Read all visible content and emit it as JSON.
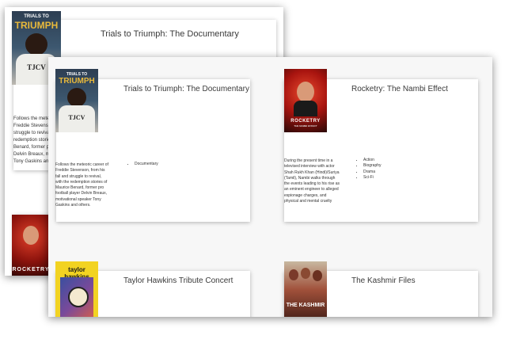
{
  "back_window": {
    "card1": {
      "title": "Trials to Triumph: The Documentary",
      "poster_text_top": "TRIALS TO",
      "poster_text_main": "TRIUMPH",
      "shirt_text": "TJCV",
      "description_lines": [
        "Follows the mete",
        "Freddie Stevensor",
        "struggle to reviva",
        "redemption storie",
        "Benard, former p",
        "Delvin Breaux, m",
        "Tony Gaskins and"
      ]
    }
  },
  "front_window": {
    "cards": [
      {
        "title": "Trials to Triumph: The Documentary",
        "poster_text_top": "TRIALS TO",
        "poster_text_main": "TRIUMPH",
        "shirt_text": "TJCV",
        "description": "Follows the meteoric career of Freddie Stevenson, from his fall and struggle to revival, with the redemption stories of Maurice Benard, former pro football player Delvin Breaux, motivational speaker Tony Gaskins and others.",
        "genres": [
          "Documentary"
        ]
      },
      {
        "title": "Rocketry: The Nambi Effect",
        "poster_text_main": "ROCKETRY",
        "poster_text_sub": "THE NAMBI EFFECT",
        "description": "During the present time in a televised interview with actor Shah Rukh Khan (Hindi)/Suriya (Tamil), Nambi walks through the events leading to his rise as an eminent engineer to alleged espionage charges, and physical and mental cruelty",
        "genres": [
          "Action",
          "Biography",
          "Drama",
          "Sci-Fi"
        ]
      },
      {
        "title": "Taylor Hawkins Tribute Concert",
        "poster_text_main": "taylor hawkins"
      },
      {
        "title": "The Kashmir Files",
        "poster_text_main": "THE KASHMIR"
      }
    ]
  },
  "colors": {
    "window_bg": "#f7f7f7",
    "card_bg": "#ffffff",
    "rocketry_red": "#a8140f",
    "taylor_yellow": "#f2d322"
  }
}
